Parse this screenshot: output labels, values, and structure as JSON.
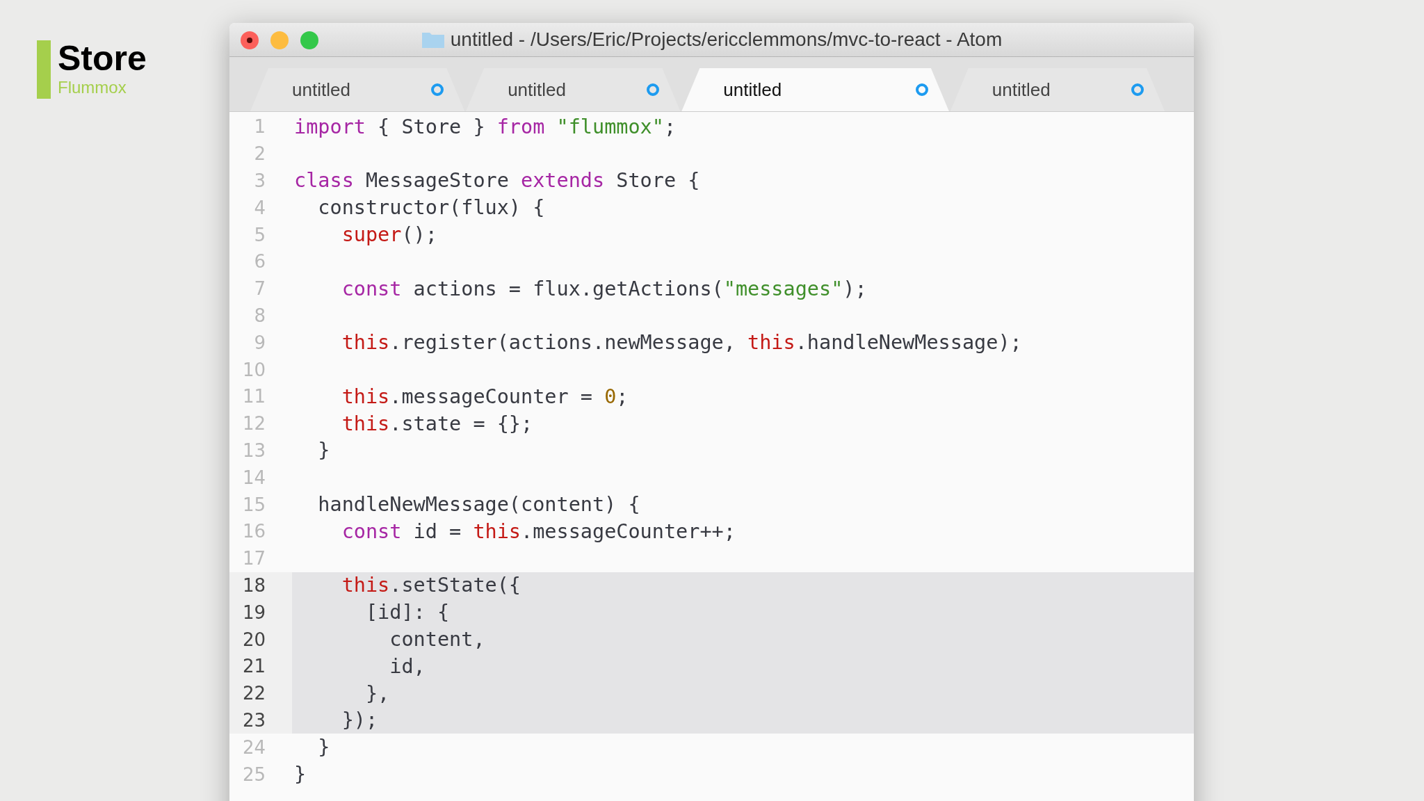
{
  "slide": {
    "title": "Store",
    "subtitle": "Flummox"
  },
  "window": {
    "title": "untitled - /Users/Eric/Projects/ericclemmons/mvc-to-react - Atom"
  },
  "tabs": [
    {
      "label": "untitled",
      "selected": false,
      "modified": true
    },
    {
      "label": "untitled",
      "selected": false,
      "modified": true
    },
    {
      "label": "untitled",
      "selected": true,
      "modified": true
    },
    {
      "label": "untitled",
      "selected": false,
      "modified": true
    }
  ],
  "editor": {
    "lines": [
      {
        "number": "1",
        "selected": false,
        "tokens": [
          {
            "kind": "kw",
            "text": "import"
          },
          {
            "kind": "plain",
            "text": " { Store } "
          },
          {
            "kind": "kw",
            "text": "from "
          },
          {
            "kind": "str",
            "text": "\"flummox\""
          },
          {
            "kind": "plain",
            "text": ";"
          }
        ]
      },
      {
        "number": "2",
        "selected": false
      },
      {
        "number": "3",
        "selected": false,
        "tokens": [
          {
            "kind": "kw",
            "text": "class"
          },
          {
            "kind": "plain",
            "text": " MessageStore "
          },
          {
            "kind": "kw",
            "text": "extends"
          },
          {
            "kind": "plain",
            "text": " Store {"
          }
        ]
      },
      {
        "number": "4",
        "selected": false,
        "tokens": [
          {
            "kind": "plain",
            "text": "  constructor(flux) {"
          }
        ]
      },
      {
        "number": "5",
        "selected": false,
        "tokens": [
          {
            "kind": "self",
            "text": "    super"
          },
          {
            "kind": "plain",
            "text": "();"
          }
        ]
      },
      {
        "number": "6",
        "selected": false
      },
      {
        "number": "7",
        "selected": false,
        "tokens": [
          {
            "kind": "kw",
            "text": "    const"
          },
          {
            "kind": "plain",
            "text": " actions = flux.getActions("
          },
          {
            "kind": "str",
            "text": "\"messages\""
          },
          {
            "kind": "plain",
            "text": ");"
          }
        ]
      },
      {
        "number": "8",
        "selected": false
      },
      {
        "number": "9",
        "selected": false,
        "tokens": [
          {
            "kind": "self",
            "text": "    this"
          },
          {
            "kind": "plain",
            "text": ".register(actions.newMessage, "
          },
          {
            "kind": "self",
            "text": "this"
          },
          {
            "kind": "plain",
            "text": ".handleNewMessage);"
          }
        ]
      },
      {
        "number": "10",
        "selected": false
      },
      {
        "number": "11",
        "selected": false,
        "tokens": [
          {
            "kind": "self",
            "text": "    this"
          },
          {
            "kind": "plain",
            "text": ".messageCounter = "
          },
          {
            "kind": "num",
            "text": "0"
          },
          {
            "kind": "plain",
            "text": ";"
          }
        ]
      },
      {
        "number": "12",
        "selected": false,
        "tokens": [
          {
            "kind": "self",
            "text": "    this"
          },
          {
            "kind": "plain",
            "text": ".state = {};"
          }
        ]
      },
      {
        "number": "13",
        "selected": false,
        "tokens": [
          {
            "kind": "plain",
            "text": "  }"
          }
        ]
      },
      {
        "number": "14",
        "selected": false
      },
      {
        "number": "15",
        "selected": false,
        "tokens": [
          {
            "kind": "plain",
            "text": "  handleNewMessage(content) {"
          }
        ]
      },
      {
        "number": "16",
        "selected": false,
        "tokens": [
          {
            "kind": "kw",
            "text": "    const"
          },
          {
            "kind": "plain",
            "text": " id = "
          },
          {
            "kind": "self",
            "text": "this"
          },
          {
            "kind": "plain",
            "text": ".messageCounter++;"
          }
        ]
      },
      {
        "number": "17",
        "selected": false
      },
      {
        "number": "18",
        "selected": true,
        "tokens": [
          {
            "kind": "self",
            "text": "    this"
          },
          {
            "kind": "plain",
            "text": ".setState({"
          }
        ]
      },
      {
        "number": "19",
        "selected": true,
        "tokens": [
          {
            "kind": "plain",
            "text": "      [id]: {"
          }
        ]
      },
      {
        "number": "20",
        "selected": true,
        "tokens": [
          {
            "kind": "plain",
            "text": "        content,"
          }
        ]
      },
      {
        "number": "21",
        "selected": true,
        "tokens": [
          {
            "kind": "plain",
            "text": "        id,"
          }
        ]
      },
      {
        "number": "22",
        "selected": true,
        "tokens": [
          {
            "kind": "plain",
            "text": "      },"
          }
        ]
      },
      {
        "number": "23",
        "selected": true,
        "tokens": [
          {
            "kind": "plain",
            "text": "    });"
          }
        ]
      },
      {
        "number": "24",
        "selected": false,
        "tokens": [
          {
            "kind": "plain",
            "text": "  }"
          }
        ]
      },
      {
        "number": "25",
        "selected": false,
        "tokens": [
          {
            "kind": "plain",
            "text": "}"
          }
        ]
      }
    ]
  }
}
